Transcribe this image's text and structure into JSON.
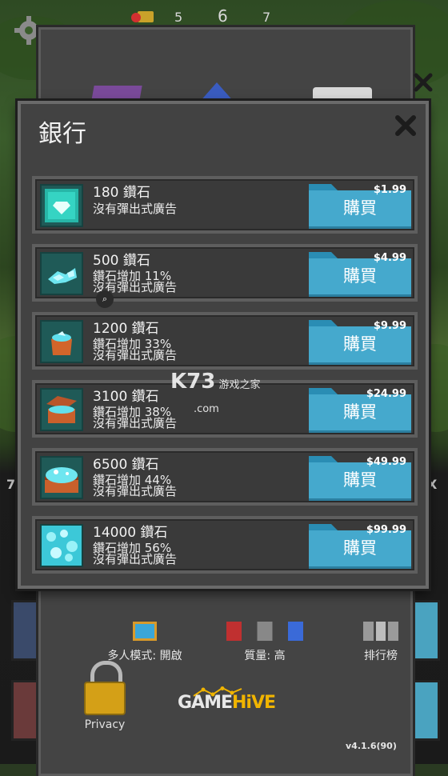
{
  "background": {
    "top_numbers": [
      "5",
      "6",
      "7"
    ],
    "edge_left": "7",
    "edge_right": "X"
  },
  "settings": {
    "multiplayer_label": "多人模式: 開啟",
    "quality_label": "質量: 高",
    "leaderboard_label": "排行榜",
    "privacy_label": "Privacy",
    "brand_game": "GAME",
    "brand_hive": "HiVE",
    "version": "v4.1.6(90)"
  },
  "bank": {
    "title": "銀行",
    "buy_label": "購買",
    "packs": [
      {
        "amount": "180 鑽石",
        "bonus": "",
        "no_ads": "沒有彈出式廣告",
        "price": "$1.99",
        "icon": "single-gem-icon"
      },
      {
        "amount": "500 鑽石",
        "bonus": "鑽石增加 11%",
        "no_ads": "沒有彈出式廣告",
        "price": "$4.99",
        "icon": "gem-handful-icon"
      },
      {
        "amount": "1200 鑽石",
        "bonus": "鑽石增加 33%",
        "no_ads": "沒有彈出式廣告",
        "price": "$9.99",
        "icon": "gem-bag-icon"
      },
      {
        "amount": "3100 鑽石",
        "bonus": "鑽石增加 38%",
        "no_ads": "沒有彈出式廣告",
        "price": "$24.99",
        "icon": "gem-chest-icon"
      },
      {
        "amount": "6500 鑽石",
        "bonus": "鑽石增加 44%",
        "no_ads": "沒有彈出式廣告",
        "price": "$49.99",
        "icon": "gem-chest-full-icon"
      },
      {
        "amount": "14000 鑽石",
        "bonus": "鑽石增加 56%",
        "no_ads": "沒有彈出式廣告",
        "price": "$99.99",
        "icon": "gem-pile-icon"
      }
    ]
  },
  "watermark": {
    "main": "K73",
    "sub": "游戏之家",
    "domain": ".com"
  },
  "colors": {
    "buy_button": "#45a9cd",
    "dialog_bg": "#424242",
    "accent_gold": "#f0b400"
  }
}
